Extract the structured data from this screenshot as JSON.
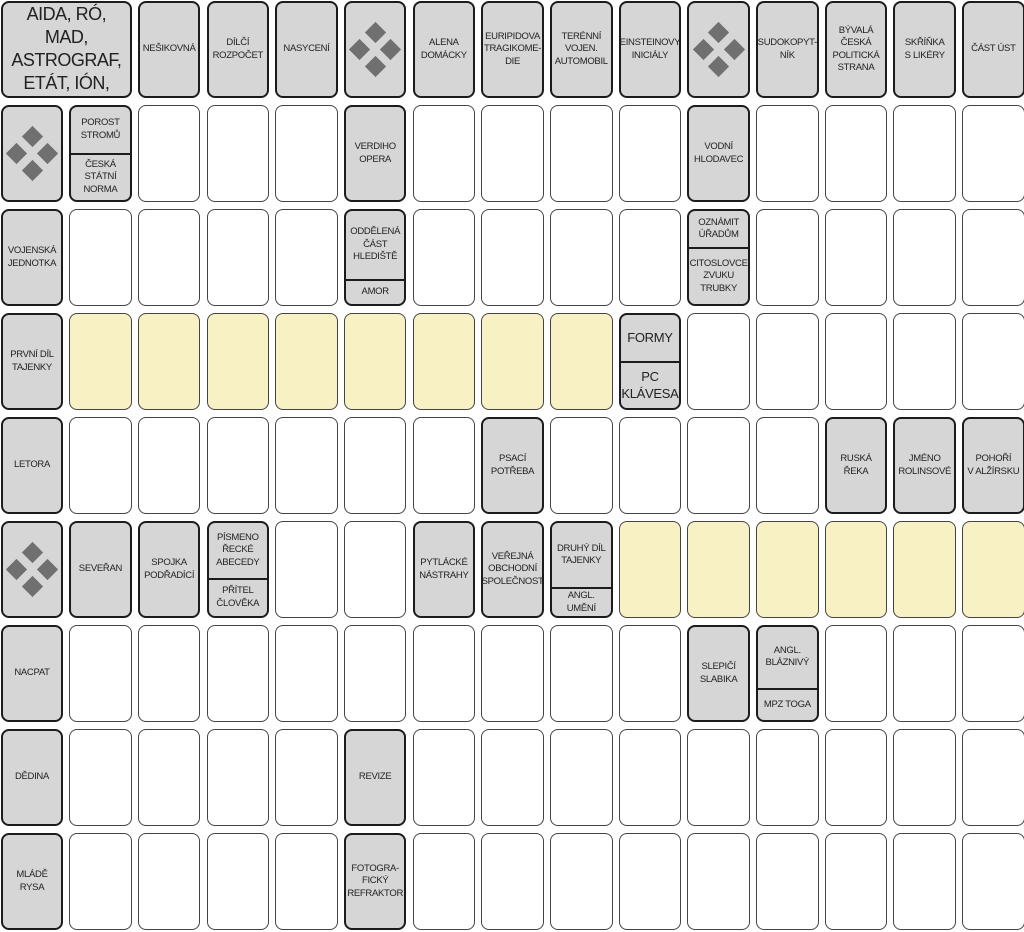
{
  "colors": {
    "clue_bg": "#d6d6d6",
    "answer_bg": "#ffffff",
    "secret_bg": "#f7f1c4",
    "diamond": "#707070"
  },
  "header_clue": "AIDA, RÓ, MAD,\nASTROGRAF,\nETÁT, IÓN, ADAF",
  "rows": [
    [
      "HEADER",
      "NEŠIKOVNÁ",
      "DÍLČÍ\nROZPOČET",
      "NASYCENÍ",
      "#",
      "ALENA\nDOMÁCKY",
      "EURIPIDOVA\nTRAGIKOME-\nDIE",
      "TERÉNNÍ\nVOJEN.\nAUTOMOBIL",
      "EINSTEINOVY\nINICIÁLY",
      "#",
      "SUDOKOPYT-\nNÍK",
      "BÝVALÁ\nČESKÁ\nPOLITICKÁ\nSTRANA",
      "SKŘÍŇKA\nS LIKÉRY",
      "ČÁST ÚST"
    ],
    [
      "#",
      [
        "POROST\nSTROMŮ",
        "ČESKÁ STÁTNÍ\nNORMA"
      ],
      "",
      "",
      "",
      "VERDIHO\nOPERA",
      "",
      "",
      "",
      "",
      "VODNÍ\nHLODAVEC",
      "",
      "",
      "",
      ""
    ],
    [
      "VOJENSKÁ\nJEDNOTKA",
      "",
      "",
      "",
      "",
      [
        "ODDĚLENÁ\nČÁST\nHLEDIŠTĚ",
        "AMOR"
      ],
      "",
      "",
      "",
      "",
      [
        "OZNÁMIT\nÚŘADŮM",
        "CITOSLOVCE\nZVUKU\nTRUBKY"
      ],
      "",
      "",
      "",
      ""
    ],
    [
      "PRVNÍ DÍL\nTAJENKY",
      "~",
      "~",
      "~",
      "~",
      "~",
      "~",
      "~",
      "~",
      [
        "FORMY",
        "PC\nKLÁVESA"
      ],
      "",
      "",
      "",
      "",
      ""
    ],
    [
      "LETORA",
      "",
      "",
      "",
      "",
      "",
      "",
      "PSACÍ\nPOTŘEBA",
      "",
      "",
      "",
      "",
      "RUSKÁ ŘEKA",
      "JMÉNO\nROLINSOVÉ",
      "POHOŘÍ\nV ALŽÍRSKU"
    ],
    [
      "#",
      "SEVEŘAN",
      "SPOJKA\nPODŘADÍCÍ",
      [
        "PÍSMENO\nŘECKÉ\nABECEDY",
        "PŘÍTEL\nČLOVĚKA"
      ],
      "",
      "",
      "PYTLÁCKÉ\nNÁSTRAHY",
      "VEŘEJNÁ\nOBCHODNÍ\nSPOLEČNOST",
      [
        "DRUHÝ DÍL\nTAJENKY",
        "ANGL. UMĚNÍ"
      ],
      "~",
      "~",
      "~",
      "~",
      "~",
      "~"
    ],
    [
      "NACPAT",
      "",
      "",
      "",
      "",
      "",
      "",
      "",
      "",
      "",
      "SLEPIČÍ\nSLABIKA",
      [
        "ANGL.\nBLÁZNIVÝ",
        "MPZ TOGA"
      ],
      "",
      "",
      ""
    ],
    [
      "DĚDINA",
      "",
      "",
      "",
      "",
      "REVIZE",
      "",
      "",
      "",
      "",
      "",
      "",
      "",
      "",
      ""
    ],
    [
      "MLÁDĚ RYSA",
      "",
      "",
      "",
      "",
      "FOTOGRA-\nFICKÝ\nREFRAKTOR",
      "",
      "",
      "",
      "",
      "",
      "",
      "",
      "",
      ""
    ]
  ]
}
